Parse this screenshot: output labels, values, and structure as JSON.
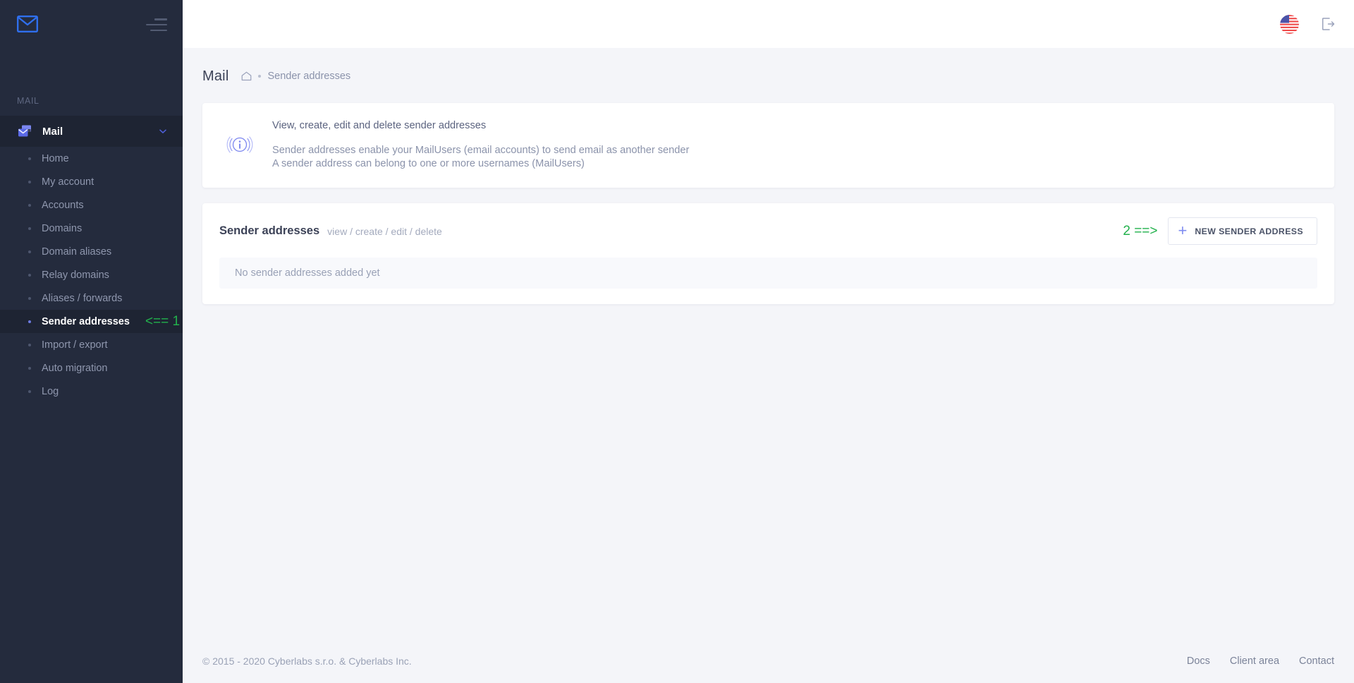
{
  "sidebar": {
    "brand_icon": "envelope-icon",
    "menu_icon": "hamburger-icon",
    "section_label": "MAIL",
    "group": {
      "label": "Mail",
      "icon": "mail-stack-icon",
      "chevron": "chevron-down-icon"
    },
    "items": [
      {
        "label": "Home",
        "active": false,
        "annotation": ""
      },
      {
        "label": "My account",
        "active": false,
        "annotation": ""
      },
      {
        "label": "Accounts",
        "active": false,
        "annotation": ""
      },
      {
        "label": "Domains",
        "active": false,
        "annotation": ""
      },
      {
        "label": "Domain aliases",
        "active": false,
        "annotation": ""
      },
      {
        "label": "Relay domains",
        "active": false,
        "annotation": ""
      },
      {
        "label": "Aliases / forwards",
        "active": false,
        "annotation": ""
      },
      {
        "label": "Sender addresses",
        "active": true,
        "annotation": "<== 1"
      },
      {
        "label": "Import / export",
        "active": false,
        "annotation": ""
      },
      {
        "label": "Auto migration",
        "active": false,
        "annotation": ""
      },
      {
        "label": "Log",
        "active": false,
        "annotation": ""
      }
    ]
  },
  "topbar": {
    "language_icon": "us-flag-icon",
    "logout_icon": "logout-icon"
  },
  "page": {
    "title": "Mail",
    "home_icon": "home-icon",
    "breadcrumb": "Sender addresses"
  },
  "info_card": {
    "icon": "info-circle-icon",
    "title": "View, create, edit and delete sender addresses",
    "line1": "Sender addresses enable your MailUsers (email accounts) to send email as another sender",
    "line2": "A sender address can belong to one or more usernames (MailUsers)"
  },
  "list_card": {
    "title": "Sender addresses",
    "subtitle": "view / create / edit / delete",
    "annotation": "2 ==>",
    "new_button": {
      "icon": "plus-icon",
      "label": "NEW SENDER ADDRESS"
    },
    "empty_message": "No sender addresses added yet"
  },
  "footer": {
    "copyright": "© 2015 - 2020 Cyberlabs s.r.o. & Cyberlabs Inc.",
    "links": [
      "Docs",
      "Client area",
      "Contact"
    ]
  },
  "colors": {
    "sidebar_bg": "#242b3d",
    "sidebar_active": "#1e2433",
    "accent": "#6c7ae0",
    "annotation_green": "#22b14c",
    "page_bg": "#f4f5f9"
  }
}
